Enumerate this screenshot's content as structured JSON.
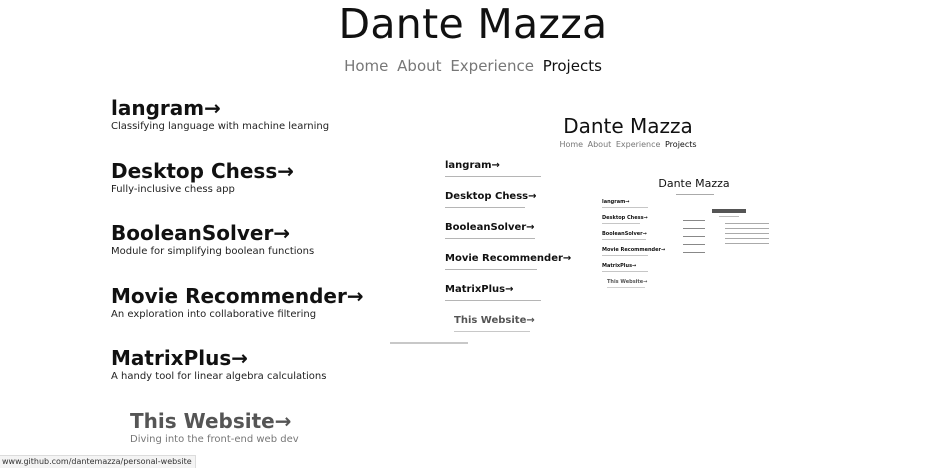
{
  "site": {
    "title": "Dante Mazza",
    "nav": [
      {
        "label": "Home"
      },
      {
        "label": "About"
      },
      {
        "label": "Experience"
      },
      {
        "label": "Projects"
      }
    ],
    "arrow": "→"
  },
  "projects": [
    {
      "title": "langram→",
      "description": "Classifying language with machine learning"
    },
    {
      "title": "Desktop Chess→",
      "description": "Fully-inclusive chess app"
    },
    {
      "title": "BooleanSolver→",
      "description": "Module for simplifying boolean functions"
    },
    {
      "title": "Movie Recommender→",
      "description": "An exploration into collaborative filtering"
    },
    {
      "title": "MatrixPlus→",
      "description": "A handy tool for linear algebra calculations"
    },
    {
      "title": "This Website→",
      "description": "Diving into the front-end web dev"
    }
  ],
  "status_bar": {
    "url": "www.github.com/dantemazza/personal-website"
  },
  "preview": {
    "title": "Dante Mazza",
    "nav": [
      "Home",
      "About",
      "Experience",
      "Projects"
    ],
    "projects": [
      "langram→",
      "Desktop Chess→",
      "BooleanSolver→",
      "Movie Recommender→",
      "MatrixPlus→",
      "This Website→"
    ]
  }
}
